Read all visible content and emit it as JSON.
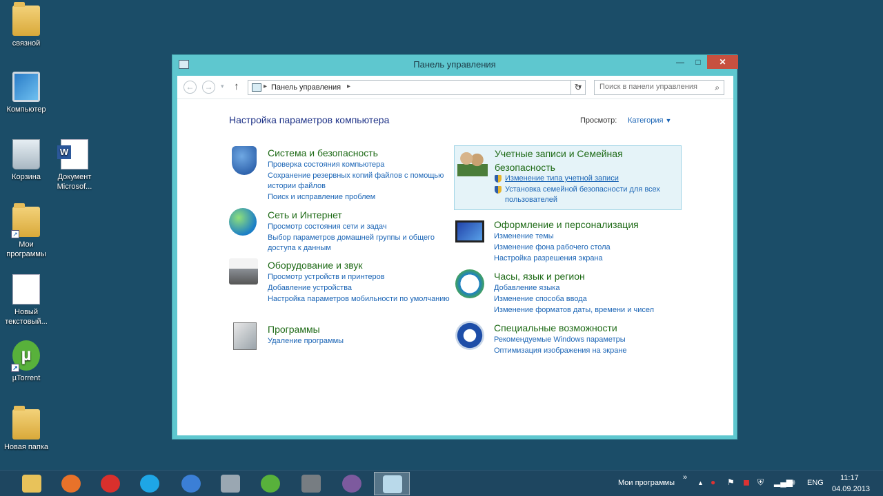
{
  "desktop": {
    "icons": [
      {
        "label": "связной"
      },
      {
        "label": "Компьютер"
      },
      {
        "label": "Корзина"
      },
      {
        "label": "Документ Microsof..."
      },
      {
        "label": "Мои программы"
      },
      {
        "label": "Новый текстовый..."
      },
      {
        "label": "µTorrent"
      },
      {
        "label": "Новая папка"
      }
    ]
  },
  "window": {
    "title": "Панель управления",
    "buttons": {
      "minimize": "—",
      "maximize": "□",
      "close": "✕"
    },
    "address": {
      "path": "Панель управления"
    },
    "search": {
      "placeholder": "Поиск в панели управления"
    },
    "page_title": "Настройка параметров компьютера",
    "view": {
      "label": "Просмотр:",
      "value": "Категория"
    },
    "categories": [
      {
        "title": "Система и безопасность",
        "icon": "security-shield-icon",
        "links": [
          "Проверка состояния компьютера",
          "Сохранение резервных копий файлов с помощью истории файлов",
          "Поиск и исправление проблем"
        ]
      },
      {
        "title": "Сеть и Интернет",
        "icon": "network-globe-icon",
        "links": [
          "Просмотр состояния сети и задач",
          "Выбор параметров домашней группы и общего доступа к данным"
        ]
      },
      {
        "title": "Оборудование и звук",
        "icon": "printer-icon",
        "links": [
          "Просмотр устройств и принтеров",
          "Добавление устройства",
          "Настройка параметров мобильности по умолчанию"
        ]
      },
      {
        "title": "Программы",
        "icon": "programs-icon",
        "links": [
          "Удаление программы"
        ]
      },
      {
        "title": "Учетные записи и Семейная безопасность",
        "icon": "users-icon",
        "links": [
          "Изменение типа учетной записи",
          "Установка семейной безопасности для всех пользователей"
        ]
      },
      {
        "title": "Оформление и персонализация",
        "icon": "display-icon",
        "links": [
          "Изменение темы",
          "Изменение фона рабочего стола",
          "Настройка разрешения экрана"
        ]
      },
      {
        "title": "Часы, язык и регион",
        "icon": "clock-globe-icon",
        "links": [
          "Добавление языка",
          "Изменение способа ввода",
          "Изменение форматов даты, времени и чисел"
        ]
      },
      {
        "title": "Специальные возможности",
        "icon": "accessibility-icon",
        "links": [
          "Рекомендуемые Windows параметры",
          "Оптимизация изображения на экране"
        ]
      }
    ]
  },
  "taskbar": {
    "toolbar_label": "Мои программы",
    "chevron": "»",
    "language": "ENG",
    "time": "11:17",
    "date": "04.09.2013",
    "apps": [
      {
        "name": "explorer-icon",
        "color": "#e8c25a"
      },
      {
        "name": "firefox-icon",
        "color": "#e8722a"
      },
      {
        "name": "yandex-browser-icon",
        "color": "#d9302c"
      },
      {
        "name": "skype-icon",
        "color": "#1ea6e6"
      },
      {
        "name": "globe-app-icon",
        "color": "#3b7fd6"
      },
      {
        "name": "monitor-app-icon",
        "color": "#9aa7b2"
      },
      {
        "name": "utorrent-icon",
        "color": "#58b13b"
      },
      {
        "name": "settings-gear-icon",
        "color": "#777d82"
      },
      {
        "name": "tor-onion-icon",
        "color": "#7d5a9e"
      },
      {
        "name": "control-panel-icon",
        "color": "#b9d9ea"
      }
    ]
  }
}
